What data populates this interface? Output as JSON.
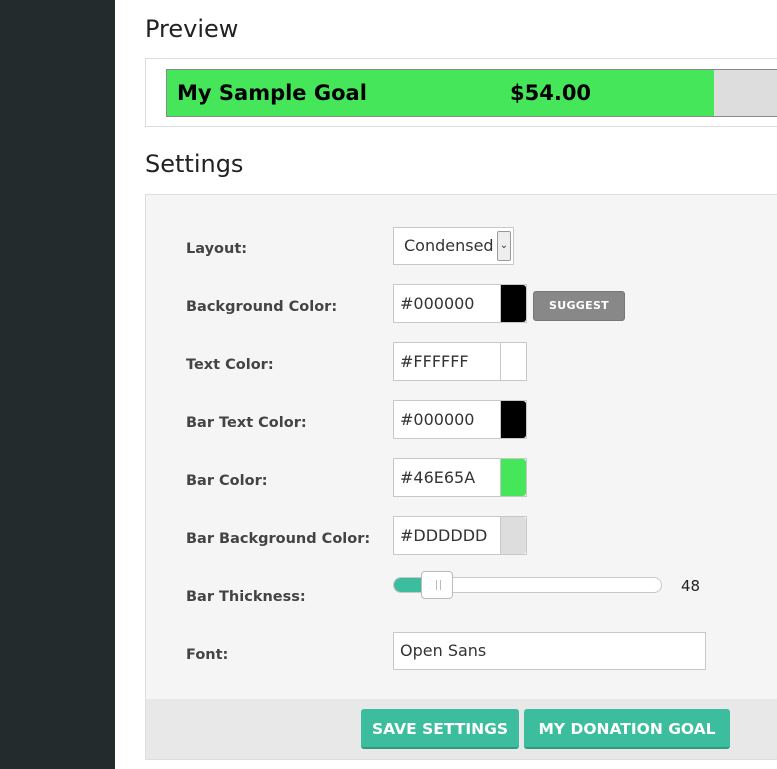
{
  "preview": {
    "title": "Preview",
    "goal_title": "My Sample Goal",
    "goal_amount": "$54.00",
    "fill_fraction": 0.871
  },
  "settings": {
    "title": "Settings",
    "layout": {
      "label": "Layout:",
      "value": "Condensed"
    },
    "background_color": {
      "label": "Background Color:",
      "value": "#000000",
      "swatch": "#000000"
    },
    "suggest_label": "SUGGEST",
    "text_color": {
      "label": "Text Color:",
      "value": "#FFFFFF",
      "swatch": "#FFFFFF"
    },
    "bar_text_color": {
      "label": "Bar Text Color:",
      "value": "#000000",
      "swatch": "#000000"
    },
    "bar_color": {
      "label": "Bar Color:",
      "value": "#46E65A",
      "swatch": "#46E65A"
    },
    "bar_background_color": {
      "label": "Bar Background Color:",
      "value": "#DDDDDD",
      "swatch": "#DDDDDD"
    },
    "bar_thickness": {
      "label": "Bar Thickness:",
      "value": "48",
      "fraction": 0.16
    },
    "font": {
      "label": "Font:",
      "value": "Open Sans"
    },
    "save_label": "SAVE SETTINGS",
    "goal_label": "MY DONATION GOAL"
  },
  "colors": {
    "sidebar": "#232b2d",
    "accent": "#3cbd9e"
  }
}
